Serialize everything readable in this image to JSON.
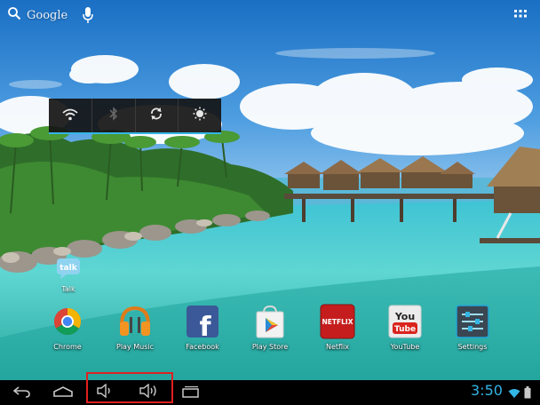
{
  "search": {
    "label": "Google"
  },
  "quick_settings": {
    "toggles": [
      {
        "name": "wifi",
        "state": "on"
      },
      {
        "name": "bluetooth",
        "state": "off"
      },
      {
        "name": "sync",
        "state": "on"
      },
      {
        "name": "brightness",
        "state": "on"
      }
    ],
    "accent_color": "#33b5e5"
  },
  "desktop": {
    "shortcuts": [
      {
        "label": "Talk",
        "icon": "talk-icon"
      }
    ]
  },
  "dock": {
    "apps": [
      {
        "label": "Chrome",
        "icon": "chrome-icon"
      },
      {
        "label": "Play Music",
        "icon": "play-music-icon"
      },
      {
        "label": "Facebook",
        "icon": "facebook-icon"
      },
      {
        "label": "Play Store",
        "icon": "play-store-icon"
      },
      {
        "label": "Netflix",
        "icon": "netflix-icon"
      },
      {
        "label": "YouTube",
        "icon": "youtube-icon"
      },
      {
        "label": "Settings",
        "icon": "settings-icon"
      }
    ]
  },
  "app_icons": {
    "talk": "talk",
    "facebook": "f",
    "netflix": "NETFLIX",
    "youtube_you": "You",
    "youtube_tube": "Tube"
  },
  "navbar": {
    "buttons": [
      "back",
      "home",
      "volume-down",
      "volume-up",
      "recent-apps"
    ],
    "highlight_color": "#e0201f"
  },
  "status": {
    "time": "3:50",
    "clock_color": "#33b5e5"
  }
}
